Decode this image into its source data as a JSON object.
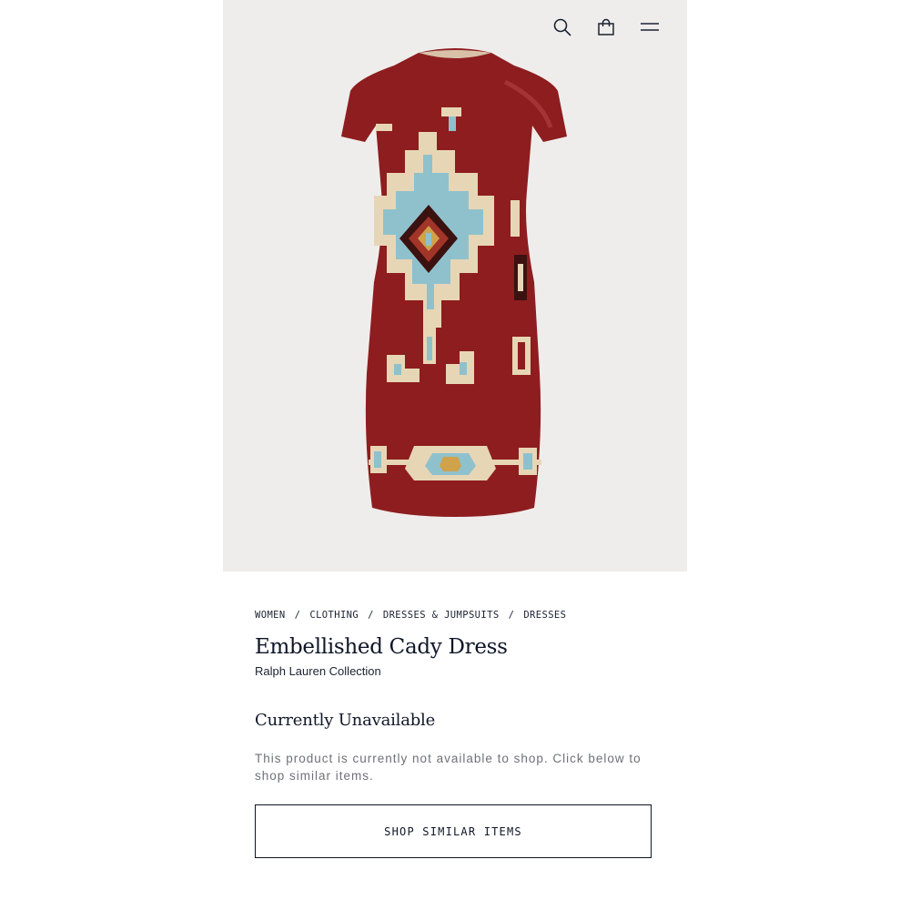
{
  "header": {
    "icons": [
      "search-icon",
      "shopping-bag-icon",
      "menu-icon"
    ]
  },
  "product_image": {
    "colors": {
      "background": "#efedec",
      "dress_red": "#8e1d1f",
      "pattern_cream": "#e7d6b6",
      "pattern_blue": "#8fc1cd",
      "pattern_dark": "#3b1210",
      "pattern_gold": "#d0a24a"
    }
  },
  "breadcrumb": {
    "items": [
      "WOMEN",
      "CLOTHING",
      "DRESSES & JUMPSUITS",
      "DRESSES"
    ],
    "separator": "/"
  },
  "product": {
    "title": "Embellished Cady Dress",
    "brand": "Ralph Lauren Collection"
  },
  "availability": {
    "heading": "Currently Unavailable",
    "message": "This product is currently not available to shop. Click below to shop similar items."
  },
  "cta": {
    "label": "SHOP SIMILAR ITEMS"
  }
}
